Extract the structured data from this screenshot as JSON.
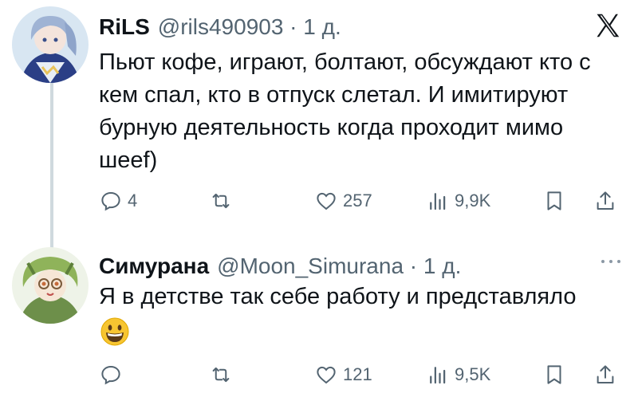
{
  "tweets": [
    {
      "display_name": "RiLS",
      "handle_meta": "@rils490903 · 1 д.",
      "text": "Пьют кофе, играют, болтают, обсуждают кто с кем спал, кто в отпуск слетал. И имитируют бурную деятельность когда проходит мимо шеef)",
      "replies": "4",
      "retweets": "",
      "likes": "257",
      "views": "9,9K"
    },
    {
      "display_name": "Симурана",
      "handle_meta": "@Moon_Simurana · 1 д.",
      "text": "Я в детстве так себе работу и представляло",
      "emoji": "grinning-face",
      "replies": "",
      "retweets": "",
      "likes": "121",
      "views": "9,5K"
    }
  ],
  "colors": {
    "text": "#0f1419",
    "secondary": "#536471",
    "thread_line": "#cfd9de"
  },
  "icons": [
    "x-logo-icon",
    "more-icon",
    "reply-icon",
    "retweet-icon",
    "like-icon",
    "views-icon",
    "bookmark-icon",
    "share-icon",
    "grinning-face-emoji"
  ]
}
